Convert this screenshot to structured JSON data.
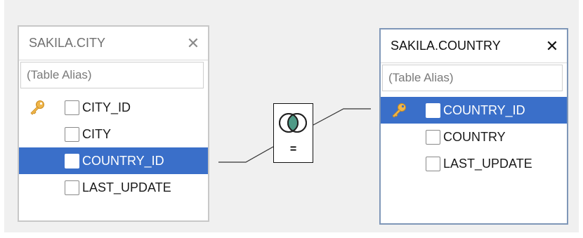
{
  "tables": [
    {
      "title": "SAKILA.CITY",
      "close_glyph": "✕",
      "alias_placeholder": "(Table Alias)",
      "columns": [
        {
          "name": "CITY_ID",
          "primary_key": true,
          "checked": false,
          "selected": false
        },
        {
          "name": "CITY",
          "primary_key": false,
          "checked": false,
          "selected": false
        },
        {
          "name": "COUNTRY_ID",
          "primary_key": false,
          "checked": false,
          "selected": true
        },
        {
          "name": "LAST_UPDATE",
          "primary_key": false,
          "checked": false,
          "selected": false
        }
      ]
    },
    {
      "title": "SAKILA.COUNTRY",
      "close_glyph": "✕",
      "alias_placeholder": "(Table Alias)",
      "columns": [
        {
          "name": "COUNTRY_ID",
          "primary_key": true,
          "checked": false,
          "selected": true
        },
        {
          "name": "COUNTRY",
          "primary_key": false,
          "checked": false,
          "selected": false
        },
        {
          "name": "LAST_UPDATE",
          "primary_key": false,
          "checked": false,
          "selected": false
        }
      ]
    }
  ],
  "join": {
    "operator": "=",
    "icon": "inner-join-venn-icon"
  },
  "colors": {
    "selection": "#3a6fc9",
    "key_gold": "#f0b64a",
    "venn_fill": "#4f9a87",
    "active_border": "#7f97b8",
    "canvas": "#f0f0f0"
  }
}
